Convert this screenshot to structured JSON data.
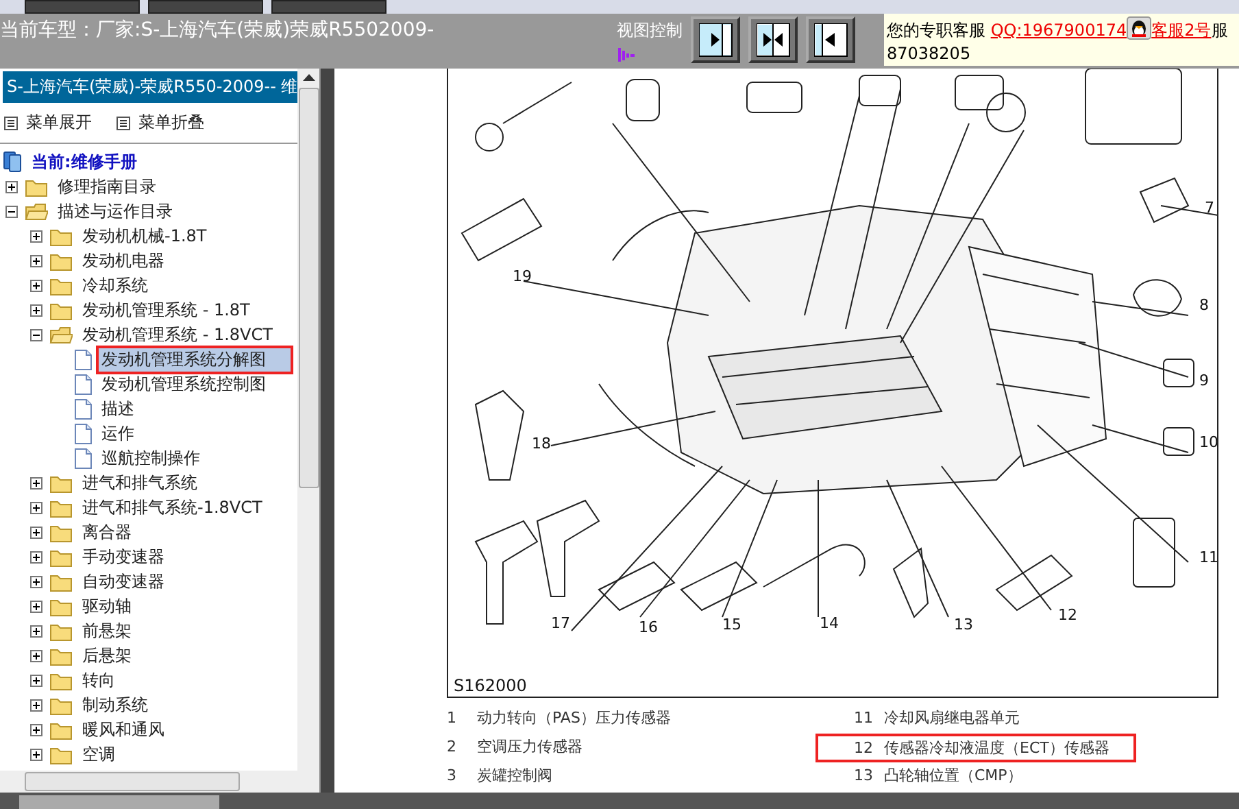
{
  "header": {
    "title": "当前车型：厂家:S-上海汽车(荣威)荣威R5502009-"
  },
  "view_control": {
    "label": "视图控制",
    "buttons": [
      {
        "kind": "expand-right"
      },
      {
        "kind": "split"
      },
      {
        "kind": "expand-left"
      }
    ]
  },
  "service": {
    "label": "您的专职客服",
    "qq_link": "QQ:1967900174",
    "agent_link": "客服2号",
    "suffix": "服",
    "phone": "87038205"
  },
  "sidebar": {
    "title": "S-上海汽车(荣威)-荣威R550-2009-- 维",
    "menu": [
      "菜单展开",
      "菜单折叠"
    ],
    "tree": {
      "label": "当前:维修手册",
      "children": [
        {
          "label": "修理指南目录",
          "kind": "folder",
          "expanded": false,
          "selected": false,
          "marked": false
        },
        {
          "label": "描述与运作目录",
          "kind": "folder",
          "expanded": true,
          "selected": false,
          "marked": false,
          "children": [
            {
              "label": "发动机机械-1.8T",
              "kind": "folder",
              "expanded": false,
              "selected": false,
              "marked": false
            },
            {
              "label": "发动机电器",
              "kind": "folder",
              "expanded": false,
              "selected": false,
              "marked": false
            },
            {
              "label": "冷却系统",
              "kind": "folder",
              "expanded": false,
              "selected": false,
              "marked": false
            },
            {
              "label": "发动机管理系统 - 1.8T",
              "kind": "folder",
              "expanded": false,
              "selected": false,
              "marked": false
            },
            {
              "label": "发动机管理系统 - 1.8VCT",
              "kind": "folder",
              "expanded": true,
              "selected": false,
              "marked": false,
              "children": [
                {
                  "label": "发动机管理系统分解图",
                  "kind": "document",
                  "selected": true,
                  "marked": true
                },
                {
                  "label": "发动机管理系统控制图",
                  "kind": "document",
                  "selected": false,
                  "marked": false
                },
                {
                  "label": "描述",
                  "kind": "document",
                  "selected": false,
                  "marked": false
                },
                {
                  "label": "运作",
                  "kind": "document",
                  "selected": false,
                  "marked": false
                },
                {
                  "label": "巡航控制操作",
                  "kind": "document",
                  "selected": false,
                  "marked": false
                }
              ]
            },
            {
              "label": "进气和排气系统",
              "kind": "folder",
              "expanded": false,
              "selected": false,
              "marked": false
            },
            {
              "label": "进气和排气系统-1.8VCT",
              "kind": "folder",
              "expanded": false,
              "selected": false,
              "marked": false
            },
            {
              "label": "离合器",
              "kind": "folder",
              "expanded": false,
              "selected": false,
              "marked": false
            },
            {
              "label": "手动变速器",
              "kind": "folder",
              "expanded": false,
              "selected": false,
              "marked": false
            },
            {
              "label": "自动变速器",
              "kind": "folder",
              "expanded": false,
              "selected": false,
              "marked": false
            },
            {
              "label": "驱动轴",
              "kind": "folder",
              "expanded": false,
              "selected": false,
              "marked": false
            },
            {
              "label": "前悬架",
              "kind": "folder",
              "expanded": false,
              "selected": false,
              "marked": false
            },
            {
              "label": "后悬架",
              "kind": "folder",
              "expanded": false,
              "selected": false,
              "marked": false
            },
            {
              "label": "转向",
              "kind": "folder",
              "expanded": false,
              "selected": false,
              "marked": false
            },
            {
              "label": "制动系统",
              "kind": "folder",
              "expanded": false,
              "selected": false,
              "marked": false
            },
            {
              "label": "暖风和通风",
              "kind": "folder",
              "expanded": false,
              "selected": false,
              "marked": false
            },
            {
              "label": "空调",
              "kind": "folder",
              "expanded": false,
              "selected": false,
              "marked": false
            }
          ]
        }
      ]
    }
  },
  "diagram": {
    "code": "S162000",
    "callouts": [
      "19",
      "7",
      "8",
      "9",
      "10",
      "18",
      "11",
      "17",
      "16",
      "15",
      "14",
      "13",
      "12"
    ]
  },
  "legend": [
    {
      "number": "1",
      "text": "动力转向（PAS）压力传感器",
      "marked": false
    },
    {
      "number": "11",
      "text": "冷却风扇继电器单元",
      "marked": false
    },
    {
      "number": "2",
      "text": "空调压力传感器",
      "marked": false
    },
    {
      "number": "12",
      "text": "传感器冷却液温度（ECT）传感器",
      "marked": true
    },
    {
      "number": "3",
      "text": "炭罐控制阀",
      "marked": false
    },
    {
      "number": "13",
      "text": "凸轮轴位置（CMP）",
      "marked": false
    }
  ]
}
